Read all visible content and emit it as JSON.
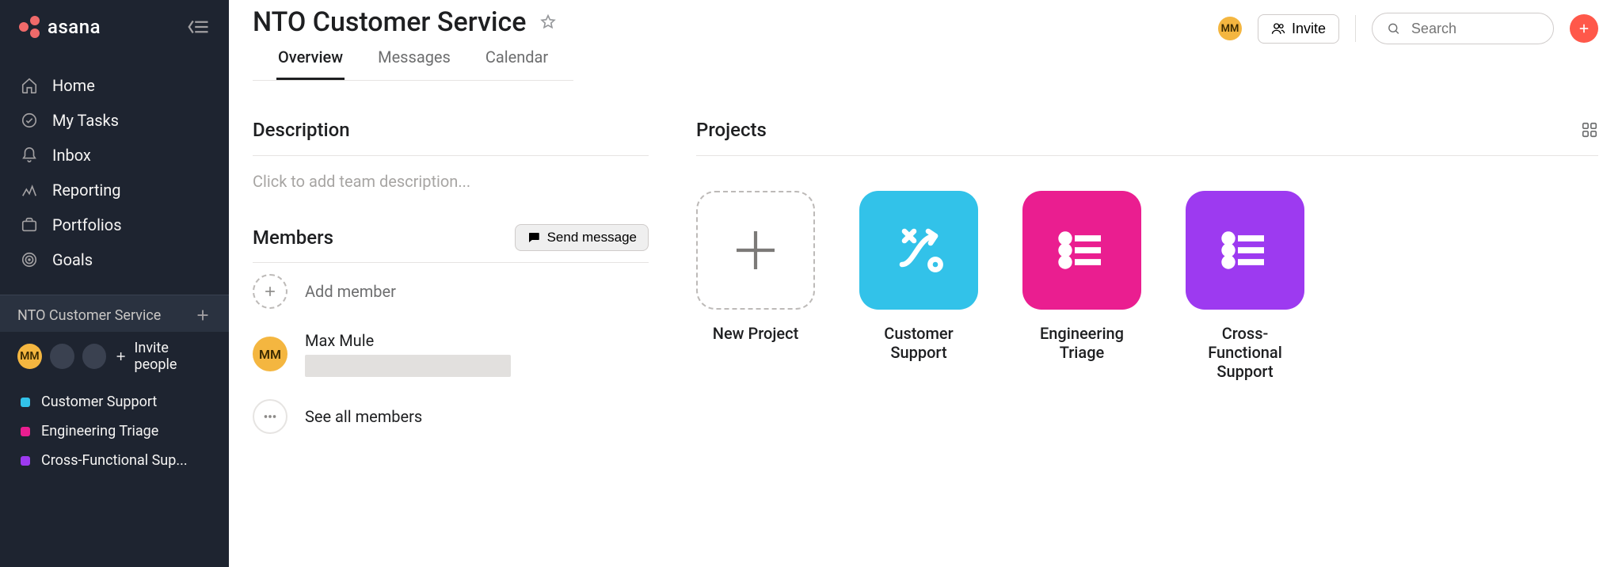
{
  "logo_text": "asana",
  "sidebar": {
    "nav": [
      {
        "label": "Home"
      },
      {
        "label": "My Tasks"
      },
      {
        "label": "Inbox"
      },
      {
        "label": "Reporting"
      },
      {
        "label": "Portfolios"
      },
      {
        "label": "Goals"
      }
    ],
    "workspace_name": "NTO Customer Service",
    "invite_people_label": "Invite people",
    "member_initials": "MM",
    "projects": [
      {
        "label": "Customer Support",
        "color": "#32c2e9"
      },
      {
        "label": "Engineering Triage",
        "color": "#ea1e90"
      },
      {
        "label": "Cross-Functional Sup...",
        "color": "#9d3af0"
      }
    ]
  },
  "header": {
    "title": "NTO Customer Service",
    "avatar_initials": "MM",
    "invite_label": "Invite",
    "search_placeholder": "Search"
  },
  "tabs": [
    {
      "label": "Overview",
      "active": true
    },
    {
      "label": "Messages",
      "active": false
    },
    {
      "label": "Calendar",
      "active": false
    }
  ],
  "description": {
    "title": "Description",
    "placeholder": "Click to add team description..."
  },
  "members": {
    "title": "Members",
    "send_message_label": "Send message",
    "add_member_label": "Add member",
    "member_name": "Max Mule",
    "member_initials": "MM",
    "see_all_label": "See all members"
  },
  "projects_section": {
    "title": "Projects",
    "cards": [
      {
        "name": "New Project",
        "color": null,
        "type": "new"
      },
      {
        "name": "Customer Support",
        "color": "#32c2e9",
        "type": "flow"
      },
      {
        "name": "Engineering Triage",
        "color": "#ea1e90",
        "type": "list"
      },
      {
        "name": "Cross-Functional Support",
        "color": "#9d3af0",
        "type": "list"
      }
    ]
  }
}
